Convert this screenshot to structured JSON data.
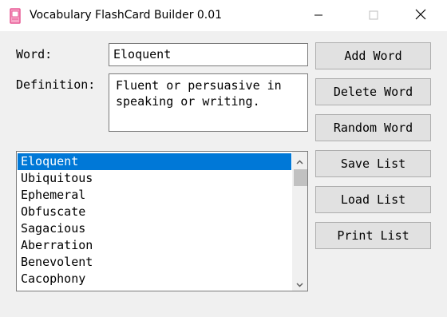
{
  "window": {
    "title": "Vocabulary FlashCard Builder 0.01"
  },
  "form": {
    "word_label": "Word:",
    "word_value": "Eloquent",
    "definition_label": "Definition:",
    "definition_value": "Fluent or persuasive in speaking or writing."
  },
  "buttons": {
    "add": "Add Word",
    "delete": "Delete Word",
    "random": "Random Word",
    "save": "Save List",
    "load": "Load List",
    "print": "Print List"
  },
  "word_list": {
    "selected": "Eloquent",
    "items": [
      "Eloquent",
      "Ubiquitous",
      "Ephemeral",
      "Obfuscate",
      "Sagacious",
      "Aberration",
      "Benevolent",
      "Cacophony"
    ]
  },
  "colors": {
    "selection": "#0078d7",
    "app_icon": "#e75a96"
  },
  "icons": {
    "app": "flashcard-app-icon",
    "minimize": "minimize-icon",
    "maximize": "maximize-icon",
    "close": "close-icon",
    "scroll_up": "chevron-up-icon",
    "scroll_down": "chevron-down-icon"
  }
}
